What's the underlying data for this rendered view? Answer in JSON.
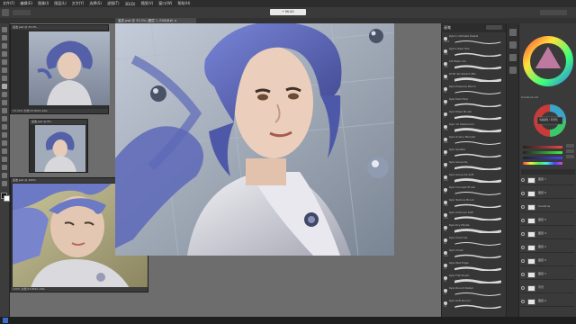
{
  "menu": [
    "文件(F)",
    "编辑(E)",
    "图像(I)",
    "图层(L)",
    "文字(Y)",
    "选择(S)",
    "滤镜(T)",
    "3D(D)",
    "视图(V)",
    "窗口(W)",
    "帮助(H)"
  ],
  "options_center": "• 90.00",
  "document_tab": "蓝发.psd @ 33.3% (图层 1, RGB/8#) ×",
  "windows": {
    "top": {
      "title": "蓝发.psd @ 33.3%",
      "status": "33.33%  文档:53.8M/1.26G"
    },
    "middle": {
      "title": "蓝发.psd @ 8%",
      "status": ""
    },
    "bottom": {
      "title": "蓝发.psd @ 100%",
      "status": "100%  文档:53.8M/1.26G"
    }
  },
  "brushes": {
    "header": "画笔",
    "items": [
      {
        "name": "Kyle's Ultimate Pastel",
        "size": "3000"
      },
      {
        "name": "Kyle's Real Oils",
        "size": "250"
      },
      {
        "name": "Lift Basic Ink",
        "size": "300"
      },
      {
        "name": "KYLE 4G Sketch Mkr",
        "size": "175"
      },
      {
        "name": "Kyle Pressure Pencil",
        "size": "50"
      },
      {
        "name": "Kyle Paint Box",
        "size": "95"
      },
      {
        "name": "Kyle Mixer Brush",
        "size": "9"
      },
      {
        "name": "Kyle 1A Watercolor",
        "size": "150"
      },
      {
        "name": "Kyle Grainy Blender",
        "size": "200"
      },
      {
        "name": "Kyle Spatter",
        "size": "80"
      },
      {
        "name": "Kyle Gouache",
        "size": "70"
      },
      {
        "name": "Kyle Gouache Soft",
        "size": "100"
      },
      {
        "name": "Kyle Concept Brush",
        "size": "45"
      },
      {
        "name": "Kyle Texture Brush",
        "size": "350"
      },
      {
        "name": "Kyle Airbrush Soft",
        "size": "180"
      },
      {
        "name": "Kyle Dry Media",
        "size": "90"
      },
      {
        "name": "Kyle Charcoal",
        "size": "60"
      },
      {
        "name": "Kyle Chalk",
        "size": "120"
      },
      {
        "name": "Kyle Wet Edge",
        "size": "22"
      },
      {
        "name": "Kyle Flat Brush",
        "size": "30"
      },
      {
        "name": "Kyle Round Detail",
        "size": "18"
      },
      {
        "name": "Kyle Soft Round",
        "size": "40"
      }
    ]
  },
  "color_panel": {
    "label": "Coolorus 2.6",
    "hint": "当前颜色 / 背景色"
  },
  "layers": [
    {
      "name": "图层 7"
    },
    {
      "name": "图层 6"
    },
    {
      "name": "Coolorus"
    },
    {
      "name": "图层 5"
    },
    {
      "name": "图层 4"
    },
    {
      "name": "图层 3"
    },
    {
      "name": "图层 2"
    },
    {
      "name": "图层 1"
    },
    {
      "name": "背景"
    },
    {
      "name": "图层 0"
    }
  ]
}
